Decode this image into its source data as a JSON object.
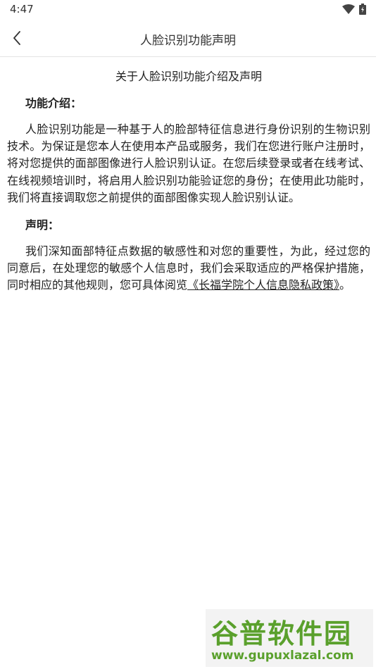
{
  "status_bar": {
    "time": "4:47",
    "wifi_icon": "wifi-icon",
    "battery_icon": "battery-charging-icon"
  },
  "nav": {
    "back_icon": "chevron-left-icon",
    "title": "人脸识别功能声明"
  },
  "content": {
    "heading": "关于人脸识别功能介绍及声明",
    "intro_title": "功能介绍：",
    "intro_text": "人脸识别功能是一种基于人的脸部特征信息进行身份识别的生物识别技术。为保证是您本人在使用本产品或服务，我们在您进行账户注册时，将对您提供的面部图像进行人脸识别认证。在您后续登录或者在线考试、在线视频培训时，将启用人脸识别功能验证您的身份；在使用此功能时，我们将直接调取您之前提供的面部图像实现人脸识别认证。",
    "statement_title": "声明：",
    "statement_text": "我们深知面部特征点数据的敏感性和对您的重要性，为此，经过您的同意后，在处理您的敏感个人信息时，我们会采取适应的严格保护措施，同时相应的其他规则，您可具体阅览",
    "policy_link": "《长福学院个人信息隐私政策》",
    "statement_end": "。"
  },
  "watermark": {
    "logo": "谷普软件园",
    "url": "www.gupuxlazal.com"
  },
  "colors": {
    "text": "#222222",
    "divider": "#e3e3e3",
    "watermark_green": "#5aa02c"
  }
}
